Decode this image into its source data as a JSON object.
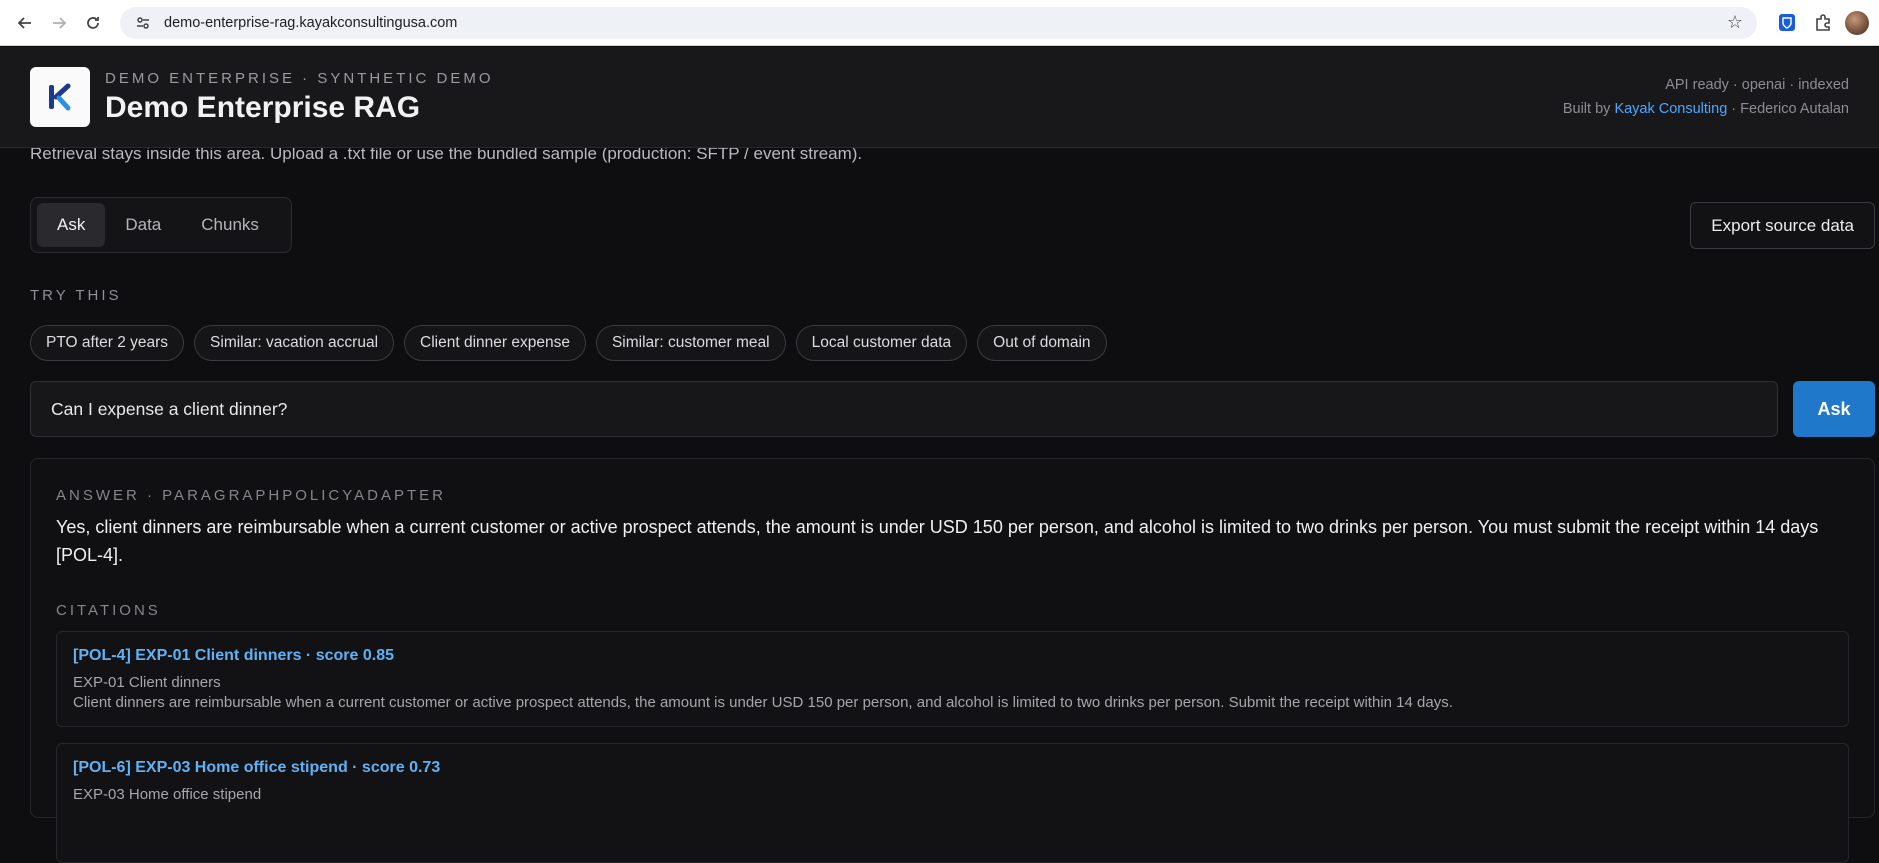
{
  "browser": {
    "url": "demo-enterprise-rag.kayakconsultingusa.com"
  },
  "header": {
    "eyebrow": "DEMO ENTERPRISE · SYNTHETIC DEMO",
    "title": "Demo Enterprise RAG",
    "status": "API ready · openai · indexed",
    "built_by_prefix": "Built by ",
    "built_by_link": "Kayak Consulting",
    "built_by_suffix": " · Federico Autalan"
  },
  "subtitle": "Retrieval stays inside this area. Upload a .txt file or use the bundled sample (production: SFTP / event stream).",
  "tabs": [
    {
      "label": "Ask",
      "active": true
    },
    {
      "label": "Data",
      "active": false
    },
    {
      "label": "Chunks",
      "active": false
    }
  ],
  "export_label": "Export source data",
  "try_label": "TRY THIS",
  "chips": [
    "PTO after 2 years",
    "Similar: vacation accrual",
    "Client dinner expense",
    "Similar: customer meal",
    "Local customer data",
    "Out of domain"
  ],
  "ask": {
    "value": "Can I expense a client dinner?",
    "button_label": "Ask"
  },
  "answer": {
    "label": "ANSWER · PARAGRAPHPOLICYADAPTER",
    "text": "Yes, client dinners are reimbursable when a current customer or active prospect attends, the amount is under USD 150 per person, and alcohol is limited to two drinks per person. You must submit the receipt within 14 days [POL-4].",
    "citations_label": "CITATIONS",
    "citations": [
      {
        "title": "[POL-4] EXP-01 Client dinners · score 0.85",
        "subtitle": "EXP-01 Client dinners",
        "body": "Client dinners are reimbursable when a current customer or active prospect attends, the amount is under USD 150 per person, and alcohol is limited to two drinks per person. Submit the receipt within 14 days."
      },
      {
        "title": "[POL-6] EXP-03 Home office stipend · score 0.73",
        "subtitle": "EXP-03 Home office stipend",
        "body": ""
      }
    ]
  },
  "colors": {
    "accent": "#1f78c9",
    "link": "#5fb2f5",
    "background": "#0e0e10"
  }
}
